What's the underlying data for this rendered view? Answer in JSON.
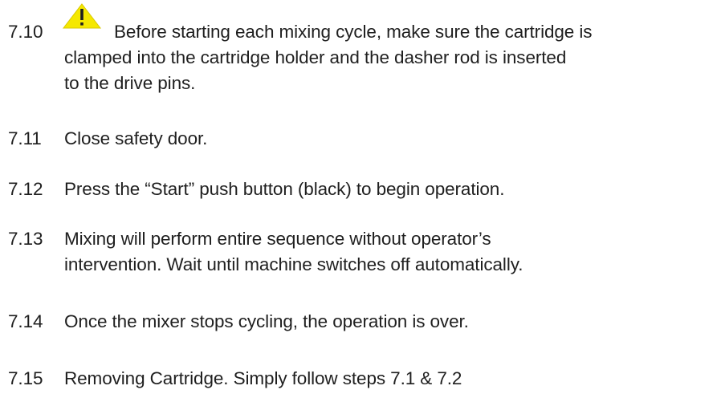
{
  "steps": [
    {
      "number": "7.10",
      "lines": [
        "Before starting each mixing cycle, make sure the cartridge is",
        "clamped  into the cartridge holder and the dasher rod is inserted",
        "to the drive pins."
      ],
      "icon": "warning-triangle-icon",
      "icon_color": "#f5e800"
    },
    {
      "number": "7.11",
      "lines": [
        "Close safety door."
      ]
    },
    {
      "number": "7.12",
      "lines": [
        "Press the “Start” push button (black) to begin operation."
      ]
    },
    {
      "number": "7.13",
      "lines": [
        "Mixing will perform entire sequence without operator’s",
        "intervention. Wait until machine switches off automatically."
      ]
    },
    {
      "number": "7.14",
      "lines": [
        "Once the mixer stops cycling, the operation is over."
      ]
    },
    {
      "number": "7.15",
      "lines": [
        "Removing Cartridge. Simply follow steps 7.1 & 7.2"
      ]
    }
  ]
}
